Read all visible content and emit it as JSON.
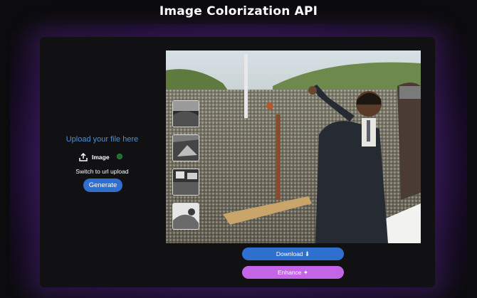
{
  "header": {
    "title": "Image Colorization API"
  },
  "upload": {
    "label": "Upload your file here",
    "chip_text": "Image",
    "switch_text": "Switch to url upload",
    "generate_label": "Generate"
  },
  "result": {
    "image_icon": "colorized-photo",
    "thumbnails": [
      "thumbnail-1",
      "thumbnail-2",
      "thumbnail-3",
      "thumbnail-4"
    ]
  },
  "actions": {
    "download_label": "Download ⬇",
    "enhance_label": "Enhance ✦"
  },
  "colors": {
    "accent_blue": "#2f6fd0",
    "accent_purple": "#c465e8",
    "link_blue": "#4d8fd4",
    "background": "#0c0c0e",
    "card": "#111114"
  }
}
